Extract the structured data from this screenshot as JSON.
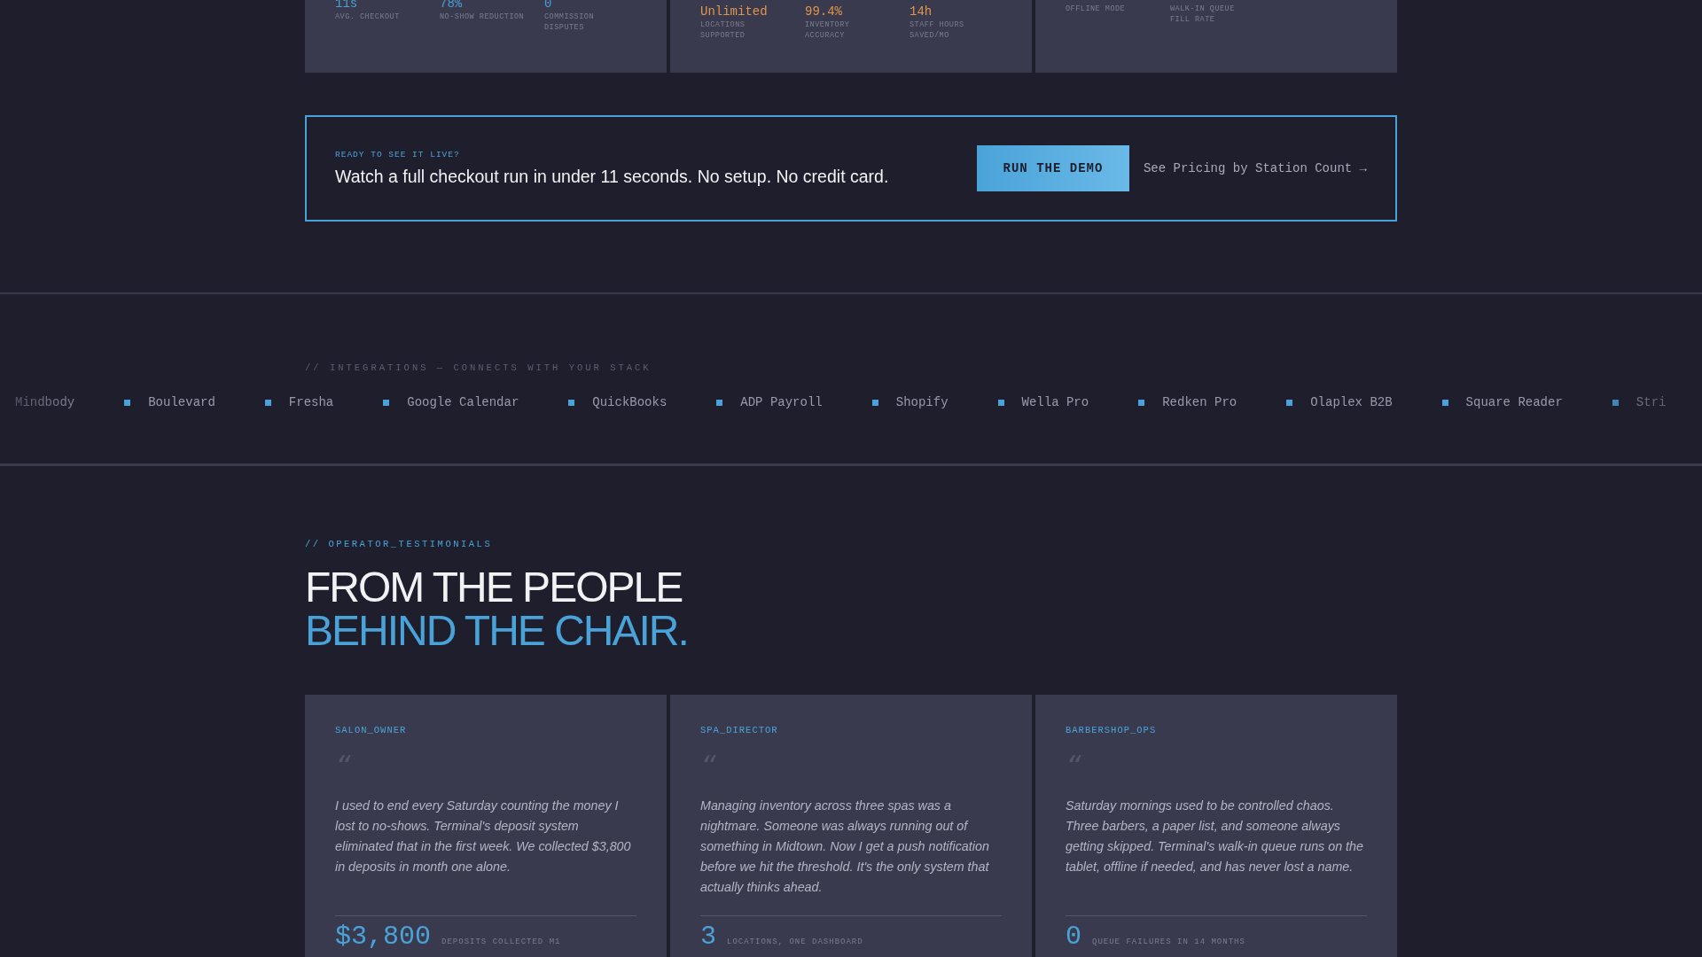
{
  "metric_cards": [
    {
      "stats": [
        {
          "value": "11s",
          "label": "AVG. CHECKOUT"
        },
        {
          "value": "78%",
          "label": "NO-SHOW REDUCTION"
        },
        {
          "value": "0",
          "label": "COMMISSION DISPUTES"
        }
      ],
      "color": "#4a9fd4"
    },
    {
      "stats": [
        {
          "value": "Unlimited",
          "label": "LOCATIONS SUPPORTED"
        },
        {
          "value": "99.4%",
          "label": "INVENTORY ACCURACY"
        },
        {
          "value": "14h",
          "label": "STAFF HOURS SAVED/MO"
        }
      ],
      "color": "#e0954a"
    },
    {
      "stats": [
        {
          "label": "OFFLINE MODE"
        },
        {
          "label": "WALK-IN QUEUE FILL RATE"
        }
      ]
    }
  ],
  "cta": {
    "eyebrow": "READY TO SEE IT LIVE?",
    "headline": "Watch a full checkout run in under 11 seconds. No setup. No credit card.",
    "button": "RUN THE DEMO",
    "link": "See Pricing by Station Count →"
  },
  "integrations": {
    "label": "// INTEGRATIONS — CONNECTS WITH YOUR STACK",
    "items": [
      {
        "name": "Mindbody",
        "marker": false
      },
      {
        "name": "Boulevard",
        "marker": true
      },
      {
        "name": "Fresha",
        "marker": true
      },
      {
        "name": "Google Calendar",
        "marker": true
      },
      {
        "name": "QuickBooks",
        "marker": true
      },
      {
        "name": "ADP Payroll",
        "marker": true
      },
      {
        "name": "Shopify",
        "marker": true
      },
      {
        "name": "Wella Pro",
        "marker": true
      },
      {
        "name": "Redken Pro",
        "marker": true
      },
      {
        "name": "Olaplex B2B",
        "marker": true
      },
      {
        "name": "Square Reader",
        "marker": true
      },
      {
        "name": "Stri",
        "marker": true
      }
    ]
  },
  "testimonials": {
    "eyebrow": "// OPERATOR_TESTIMONIALS",
    "heading_line_1": "FROM THE PEOPLE",
    "heading_line_2": "BEHIND THE CHAIR.",
    "quote_mark": "“",
    "cards": [
      {
        "role": "SALON_OWNER",
        "quote": "I used to end every Saturday counting the money I lost to no-shows. Terminal's deposit system eliminated that in the first week. We collected $3,800 in deposits in month one alone.",
        "stat": "$3,800",
        "stat_label": "DEPOSITS COLLECTED M1"
      },
      {
        "role": "SPA_DIRECTOR",
        "quote": "Managing inventory across three spas was a nightmare. Someone was always running out of something in Midtown. Now I get a push notification before we hit the threshold. It's the only system that actually thinks ahead.",
        "stat": "3",
        "stat_label": "LOCATIONS, ONE DASHBOARD"
      },
      {
        "role": "BARBERSHOP_OPS",
        "quote": "Saturday mornings used to be controlled chaos. Three barbers, a paper list, and someone always getting skipped. Terminal's walk-in queue runs on the tablet, offline if needed, and has never lost a name.",
        "stat": "0",
        "stat_label": "QUEUE FAILURES IN 14 MONTHS"
      }
    ]
  }
}
